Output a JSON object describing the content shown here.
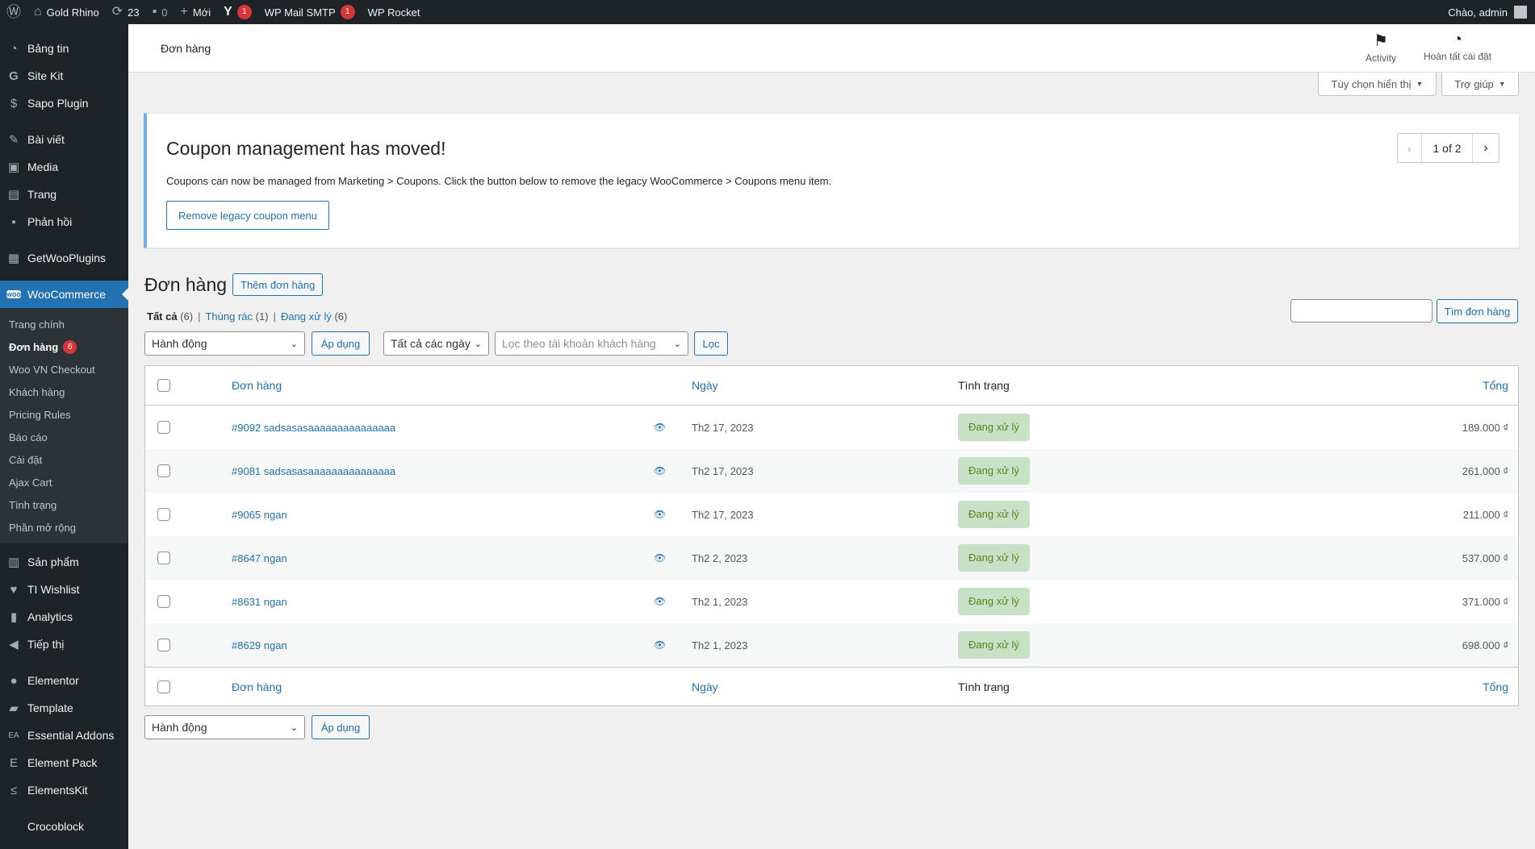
{
  "adminbar": {
    "site_name": "Gold Rhino",
    "updates_count": "23",
    "comments_count": "0",
    "new_label": "Mới",
    "yoast_badge": "1",
    "smtp_label": "WP Mail SMTP",
    "smtp_badge": "1",
    "rocket_label": "WP Rocket",
    "greeting": "Chào, admin"
  },
  "sidebar": {
    "items_top": [
      {
        "label": "Bảng tin",
        "icon": "dashboard-icon"
      },
      {
        "label": "Site Kit",
        "icon": "google-icon"
      },
      {
        "label": "Sapo Plugin",
        "icon": "dollar-icon"
      }
    ],
    "items_content": [
      {
        "label": "Bài viết",
        "icon": "pin-icon"
      },
      {
        "label": "Media",
        "icon": "media-icon"
      },
      {
        "label": "Trang",
        "icon": "page-icon"
      },
      {
        "label": "Phản hồi",
        "icon": "comment-icon"
      }
    ],
    "getwoo": "GetWooPlugins",
    "woocommerce": "WooCommerce",
    "woo_submenu": [
      "Trang chính",
      "Đơn hàng",
      "Woo VN Checkout",
      "Khách hàng",
      "Pricing Rules",
      "Báo cáo",
      "Cài đặt",
      "Ajax Cart",
      "Tình trạng",
      "Phần mở rộng"
    ],
    "orders_badge": "6",
    "items_shop": [
      {
        "label": "Sản phẩm",
        "icon": "archive-icon"
      },
      {
        "label": "TI Wishlist",
        "icon": "heart-icon"
      },
      {
        "label": "Analytics",
        "icon": "bar-chart-icon"
      },
      {
        "label": "Tiếp thị",
        "icon": "megaphone-icon"
      }
    ],
    "items_builders": [
      {
        "label": "Elementor",
        "icon": "elementor-icon"
      },
      {
        "label": "Template",
        "icon": "folder-icon"
      },
      {
        "label": "Essential Addons",
        "icon": "ea-icon"
      },
      {
        "label": "Element Pack",
        "icon": "element-pack-icon"
      },
      {
        "label": "ElementsKit",
        "icon": "elementskit-icon"
      }
    ],
    "crocoblock": "Crocoblock"
  },
  "header": {
    "title": "Đơn hàng",
    "activity": "Activity",
    "finish_setup": "Hoàn tất cài đặt"
  },
  "screen_options": {
    "display": "Tùy chọn hiển thị",
    "help": "Trợ giúp"
  },
  "notice": {
    "title": "Coupon management has moved!",
    "text": "Coupons can now be managed from Marketing > Coupons. Click the button below to remove the legacy WooCommerce > Coupons menu item.",
    "button": "Remove legacy coupon menu",
    "pager": "1 of 2"
  },
  "page": {
    "heading": "Đơn hàng",
    "add_new": "Thêm đơn hàng",
    "views": [
      {
        "label": "Tất cả",
        "count": "(6)"
      },
      {
        "label": "Thùng rác",
        "count": "(1)"
      },
      {
        "label": "Đang xử lý",
        "count": "(6)"
      }
    ],
    "search_button": "Tìm đơn hàng",
    "bulk_action": "Hành động",
    "apply": "Áp dụng",
    "date_filter": "Tất cả các ngày",
    "customer_filter_placeholder": "Lọc theo tài khoản khách hàng",
    "filter_button": "Lọc"
  },
  "table": {
    "columns": {
      "order": "Đơn hàng",
      "date": "Ngày",
      "status": "Tình trạng",
      "total": "Tổng"
    },
    "rows": [
      {
        "order": "#9092 sadsasasaaaaaaaaaaaaaaa",
        "date": "Th2 17, 2023",
        "status": "Đang xử lý",
        "total": "189.000 ₫"
      },
      {
        "order": "#9081 sadsasasaaaaaaaaaaaaaaa",
        "date": "Th2 17, 2023",
        "status": "Đang xử lý",
        "total": "261.000 ₫"
      },
      {
        "order": "#9065 ngan",
        "date": "Th2 17, 2023",
        "status": "Đang xử lý",
        "total": "211.000 ₫"
      },
      {
        "order": "#8647 ngan",
        "date": "Th2 2, 2023",
        "status": "Đang xử lý",
        "total": "537.000 ₫"
      },
      {
        "order": "#8631 ngan",
        "date": "Th2 1, 2023",
        "status": "Đang xử lý",
        "total": "371.000 ₫"
      },
      {
        "order": "#8629 ngan",
        "date": "Th2 1, 2023",
        "status": "Đang xử lý",
        "total": "698.000 ₫"
      }
    ]
  }
}
